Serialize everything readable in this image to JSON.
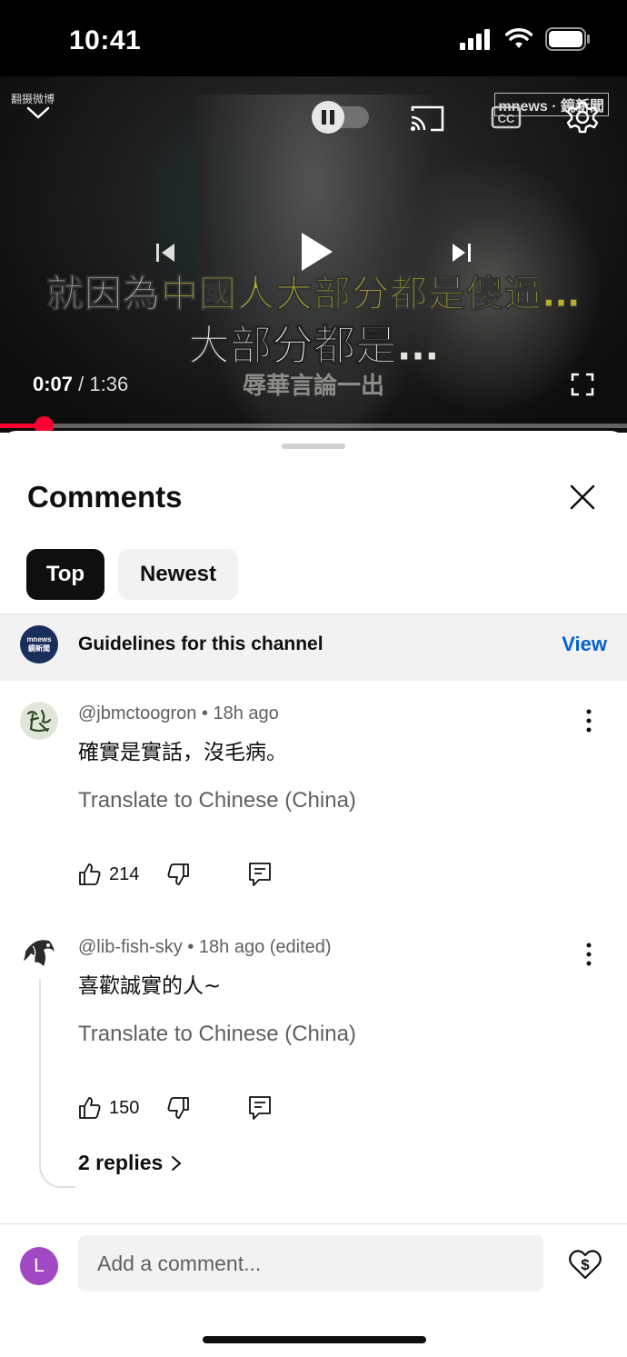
{
  "status_bar": {
    "time": "10:41"
  },
  "video": {
    "watermark_left": "翻摄微博",
    "watermark_right": "mnews · 鏡新聞",
    "subtitle_line1_pre": "就因為",
    "subtitle_line1_hl": "中國人大部分都是傻逼…",
    "subtitle_line2": "大部分都是…",
    "subtitle_line3": "辱華言論一出",
    "current_time": "0:07",
    "separator": " / ",
    "duration": "1:36",
    "progress": 0.07
  },
  "sheet": {
    "title": "Comments",
    "chips": [
      "Top",
      "Newest"
    ],
    "guidelines": {
      "avatar_line1": "mnews",
      "avatar_line2": "鏡新聞",
      "text": "Guidelines for this channel",
      "action": "View"
    }
  },
  "comments": [
    {
      "author": "@jbmctoogron",
      "time": "18h ago",
      "edited": "",
      "text": "確實是實話，沒毛病。",
      "translate": "Translate to Chinese (China)",
      "likes": "214"
    },
    {
      "author": "@lib-fish-sky",
      "time": "18h ago",
      "edited": "(edited)",
      "text": "喜歡誠實的人~",
      "translate": "Translate to Chinese (China)",
      "likes": "150",
      "replies": "2 replies"
    }
  ],
  "composer": {
    "avatar_letter": "L",
    "placeholder": "Add a comment..."
  },
  "colors": {
    "accent": "#065fd4",
    "progress": "#ff0033",
    "avatar_me": "#a148c4"
  }
}
